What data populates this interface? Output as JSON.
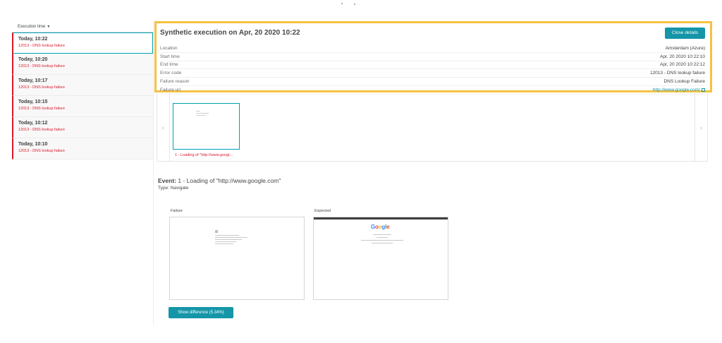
{
  "sidebar": {
    "sort_label": "Execution time",
    "items": [
      {
        "time": "Today, 10:22",
        "error": "12013 - DNS lookup failure"
      },
      {
        "time": "Today, 10:20",
        "error": "12013 - DNS lookup failure"
      },
      {
        "time": "Today, 10:17",
        "error": "12013 - DNS lookup failure"
      },
      {
        "time": "Today, 10:15",
        "error": "12013 - DNS lookup failure"
      },
      {
        "time": "Today, 10:12",
        "error": "12013 - DNS lookup failure"
      },
      {
        "time": "Today, 10:10",
        "error": "12013 - DNS lookup failure"
      }
    ]
  },
  "details": {
    "title": "Synthetic execution on Apr, 20 2020 10:22",
    "close_label": "Close details",
    "rows": [
      {
        "label": "Location",
        "value": "Amsterdam (Azure)"
      },
      {
        "label": "Start time",
        "value": "Apr, 20 2020 10:22:10"
      },
      {
        "label": "End time",
        "value": "Apr, 20 2020 10:22:12"
      },
      {
        "label": "Error code",
        "value": "12013 - DNS lookup failure"
      },
      {
        "label": "Failure reason",
        "value": "DNS Lookup Failure"
      },
      {
        "label": "Failure url",
        "value": "http://www.google.com/"
      }
    ]
  },
  "filmstrip": {
    "prev_icon": "‹",
    "next_icon": "›",
    "thumb_label": "1 - Loading of \"http://www.googl..."
  },
  "event": {
    "title_prefix": "Event:",
    "title_text": " 1 - Loading of \"http://www.google.com\"",
    "type": "Type: Navigate"
  },
  "screenshots": {
    "failure_label": "Failure",
    "expected_label": "Expected"
  },
  "google_logo": {
    "g1": "G",
    "o1": "o",
    "o2": "o",
    "g2": "g",
    "l": "l",
    "e": "e"
  },
  "show_difference_label": "Show difference (5.34%)",
  "colors": {
    "accent": "#1496a8",
    "error": "#dc172a",
    "highlight": "#f5c242"
  }
}
